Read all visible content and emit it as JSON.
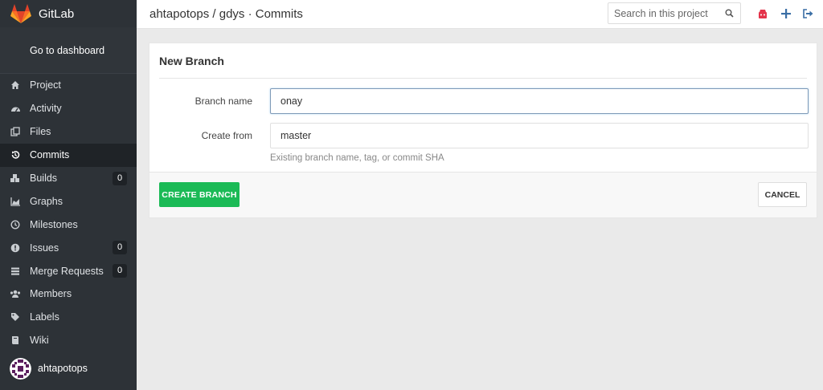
{
  "sidebar": {
    "brand": "GitLab",
    "dashboard_link": "Go to dashboard",
    "items": [
      {
        "label": "Project",
        "icon": "home-icon"
      },
      {
        "label": "Activity",
        "icon": "dashboard-icon"
      },
      {
        "label": "Files",
        "icon": "files-icon"
      },
      {
        "label": "Commits",
        "icon": "history-icon",
        "active": true
      },
      {
        "label": "Builds",
        "icon": "cubes-icon",
        "badge": "0"
      },
      {
        "label": "Graphs",
        "icon": "area-chart-icon"
      },
      {
        "label": "Milestones",
        "icon": "clock-icon"
      },
      {
        "label": "Issues",
        "icon": "exclamation-circle-icon",
        "badge": "0"
      },
      {
        "label": "Merge Requests",
        "icon": "tasks-icon",
        "badge": "0"
      },
      {
        "label": "Members",
        "icon": "users-icon"
      },
      {
        "label": "Labels",
        "icon": "tags-icon"
      },
      {
        "label": "Wiki",
        "icon": "book-icon"
      }
    ],
    "user": "ahtapotops"
  },
  "header": {
    "breadcrumb": "ahtapotops / gdys · Commits",
    "search_placeholder": "Search in this project"
  },
  "form": {
    "title": "New Branch",
    "branch_name_label": "Branch name",
    "branch_name_value": "onay",
    "create_from_label": "Create from",
    "create_from_value": "master",
    "help_text": "Existing branch name, tag, or commit SHA",
    "create_button": "CREATE BRANCH",
    "cancel_button": "CANCEL"
  },
  "colors": {
    "sidebar_bg": "#2d3237",
    "accent_green": "#1bba56",
    "icon_red": "#e4344b",
    "icon_blue": "#3a6ea5"
  }
}
